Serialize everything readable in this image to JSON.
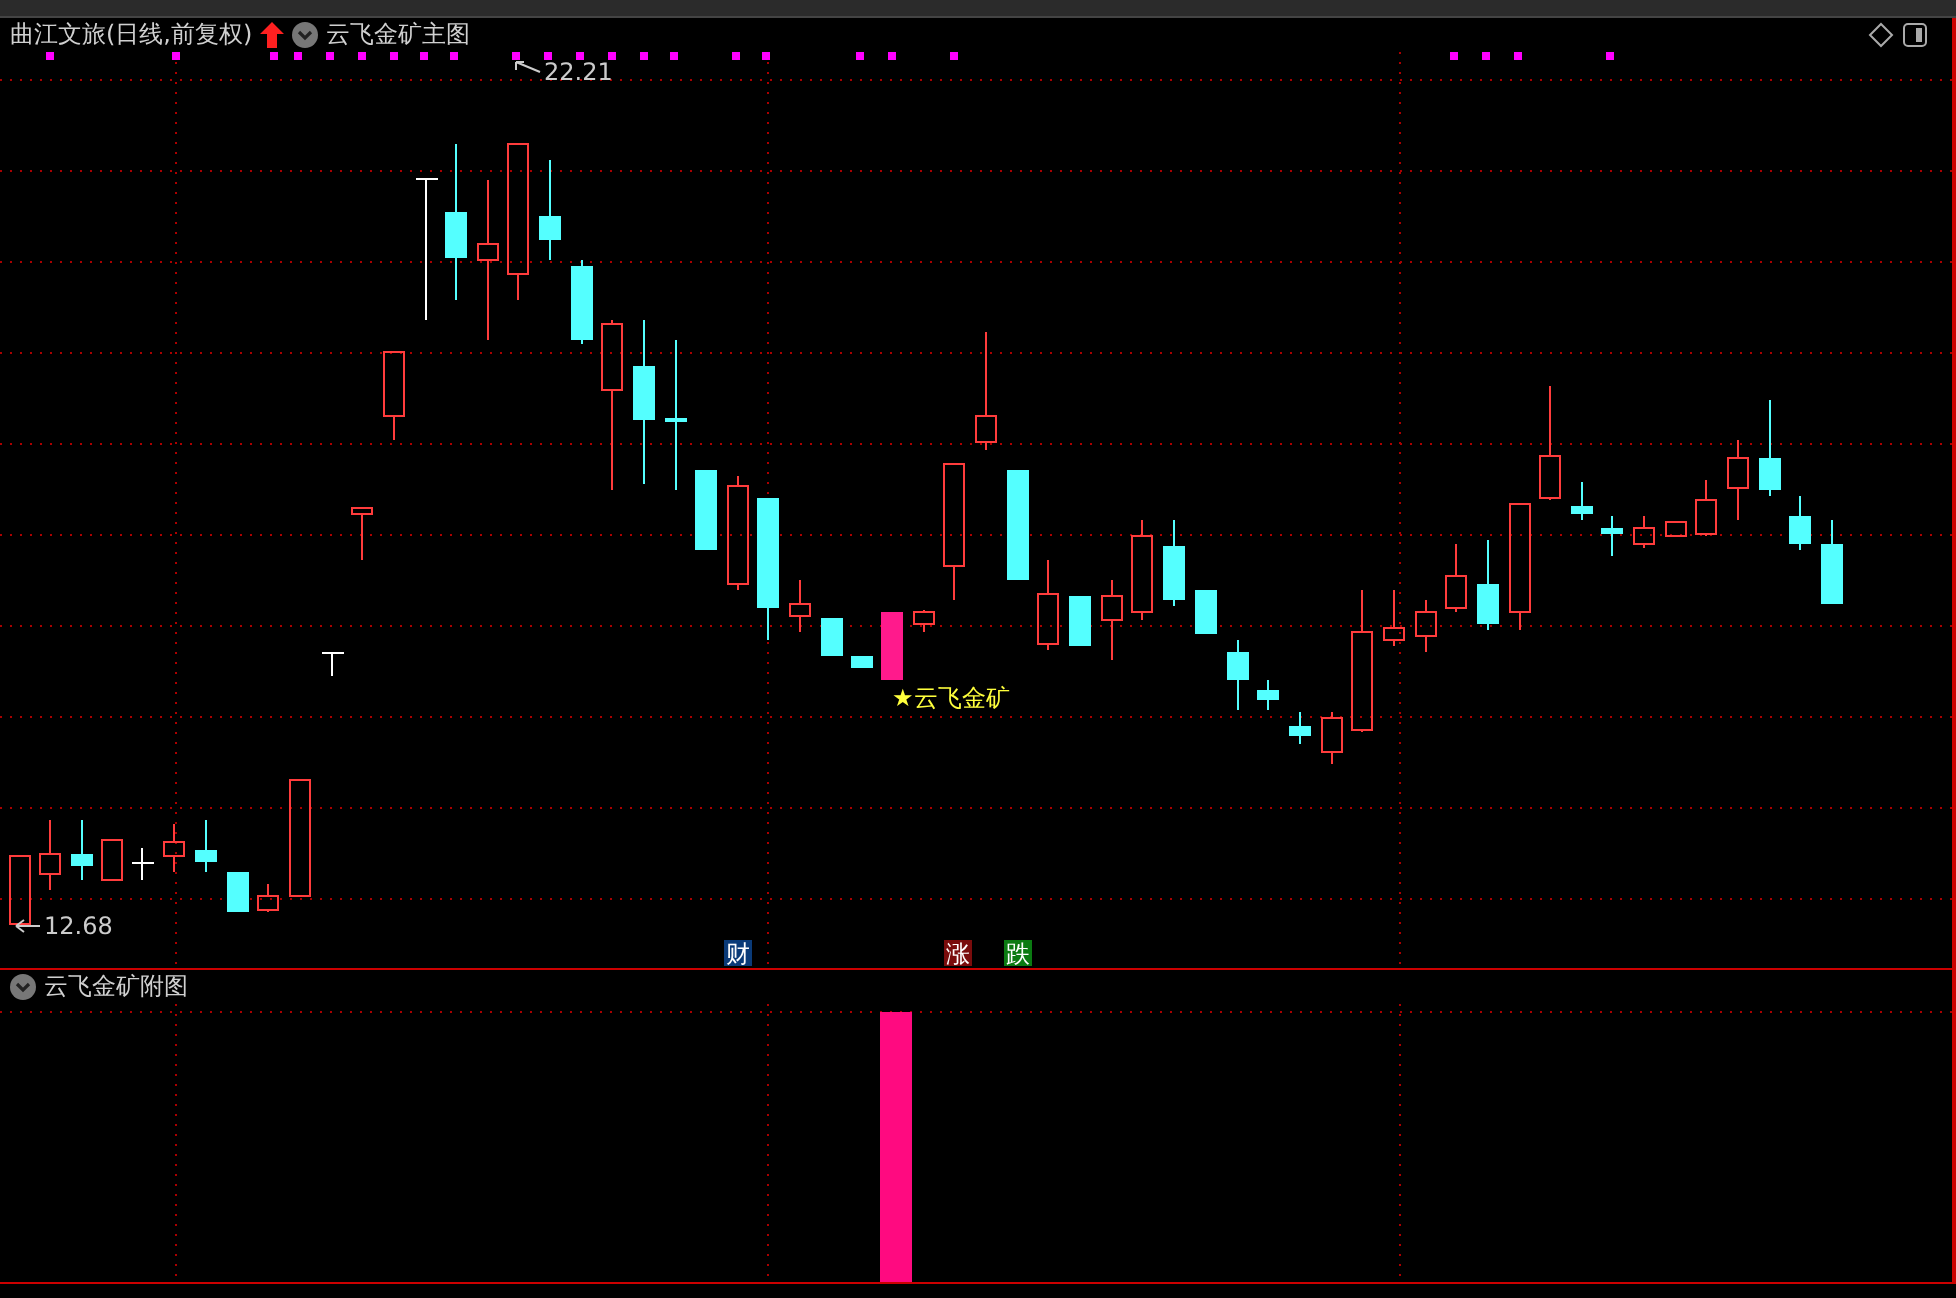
{
  "chart_header": {
    "title": "曲江文旅(日线,前复权)",
    "indicator": "云飞金矿主图"
  },
  "price_labels": [
    {
      "kind": "high",
      "text": "22.21"
    },
    {
      "kind": "low",
      "text": "12.68"
    }
  ],
  "signal_label": "★云飞金矿",
  "event_badges": [
    {
      "text": "财",
      "color": "#0a3a78"
    },
    {
      "text": "涨",
      "color": "#7a0c0c"
    },
    {
      "text": "跌",
      "color": "#0b7a12"
    }
  ],
  "sub_panel": {
    "title": "云飞金矿附图"
  }
}
